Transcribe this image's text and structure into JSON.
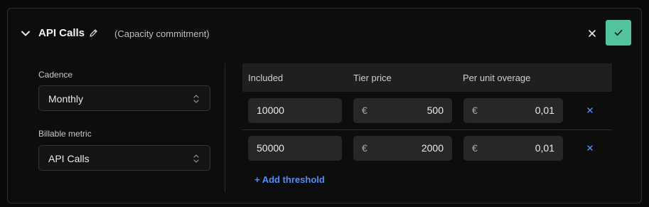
{
  "header": {
    "title": "API Calls",
    "subtitle": "(Capacity commitment)"
  },
  "fields": {
    "cadence_label": "Cadence",
    "cadence_value": "Monthly",
    "metric_label": "Billable metric",
    "metric_value": "API Calls"
  },
  "table": {
    "columns": [
      "Included",
      "Tier price",
      "Per unit overage"
    ],
    "currency_symbol": "€",
    "rows": [
      {
        "included": "10000",
        "tier_price": "500",
        "overage": "0,01"
      },
      {
        "included": "50000",
        "tier_price": "2000",
        "overage": "0,01"
      }
    ]
  },
  "add_threshold_label": "+ Add threshold",
  "colors": {
    "confirm": "#52c39a",
    "link": "#4f8ff7",
    "remove": "#4f8ff7"
  },
  "icons": {
    "collapse": "chevron-down-icon",
    "edit": "pencil-icon",
    "close": "close-icon",
    "confirm": "check-icon",
    "select": "chevron-up-down-icon",
    "remove": "x-icon"
  }
}
